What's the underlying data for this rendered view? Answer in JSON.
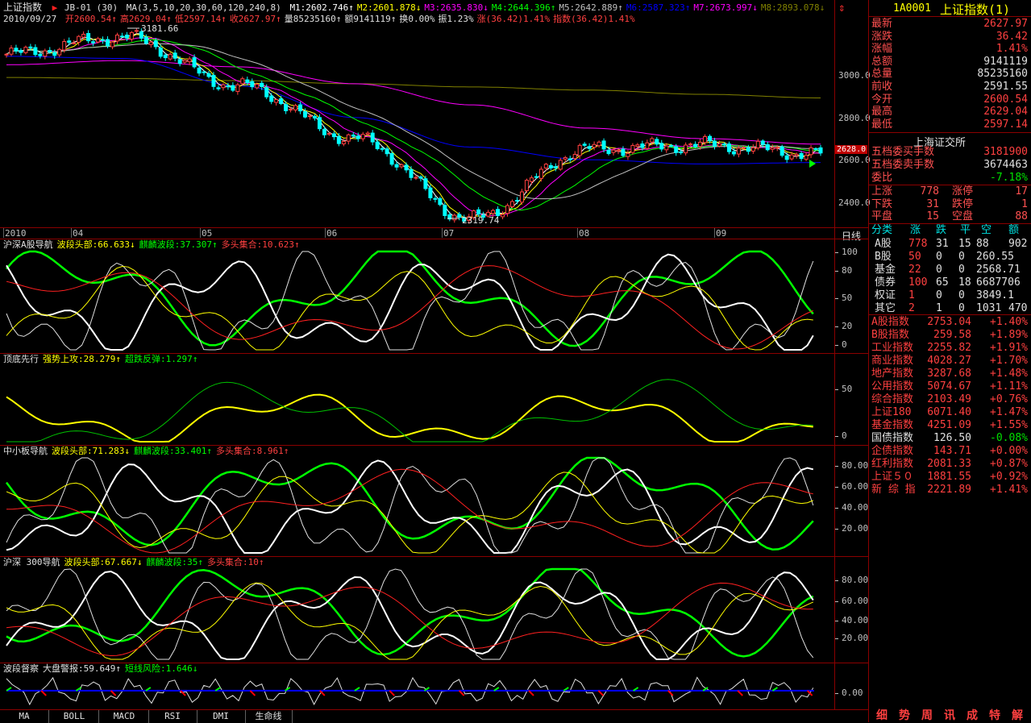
{
  "title": {
    "name": "上证指数",
    "formula": "JB-01 (30)",
    "ma_params": "MA(3,5,10,20,30,60,120,240,8)",
    "date": "2010/09/27"
  },
  "ma_values": [
    {
      "label": "M1:2602.746",
      "color": "#ffffff",
      "arrow": "↑"
    },
    {
      "label": "M2:2601.878",
      "color": "#ffff00",
      "arrow": "↓"
    },
    {
      "label": "M3:2635.830",
      "color": "#ff00ff",
      "arrow": "↓"
    },
    {
      "label": "M4:2644.396",
      "color": "#00ff00",
      "arrow": "↑"
    },
    {
      "label": "M5:2642.889",
      "color": "#c0c0c0",
      "arrow": "↑"
    },
    {
      "label": "M6:2587.323",
      "color": "#0000ff",
      "arrow": "↑"
    },
    {
      "label": "M7:2673.997",
      "color": "#ff00ff",
      "arrow": "↓"
    },
    {
      "label": "M8:2893.078",
      "color": "#808000",
      "arrow": "↓"
    }
  ],
  "ohlc_line": [
    {
      "label": "开2600.54",
      "color": "#ff4040",
      "arrow": "↑"
    },
    {
      "label": "高2629.04",
      "color": "#ff4040",
      "arrow": "↑"
    },
    {
      "label": "低2597.14",
      "color": "#ff4040",
      "arrow": "↑"
    },
    {
      "label": "收2627.97",
      "color": "#ff4040",
      "arrow": "↑"
    },
    {
      "label": "量85235160",
      "color": "#e0e0e0",
      "arrow": "↑"
    },
    {
      "label": "额9141119",
      "color": "#e0e0e0",
      "arrow": "↑"
    },
    {
      "label": "换0.00%",
      "color": "#e0e0e0",
      "arrow": ""
    },
    {
      "label": "振1.23%",
      "color": "#e0e0e0",
      "arrow": ""
    },
    {
      "label": "涨(36.42)1.41%",
      "color": "#ff4040",
      "arrow": ""
    },
    {
      "label": "指数(36.42)1.41%",
      "color": "#ff4040",
      "arrow": ""
    }
  ],
  "main_chart": {
    "y_ticks": [
      "3000.0",
      "2800.0",
      "2600.0",
      "2400.0"
    ],
    "high_label": "3181.66",
    "low_label": "2319.74",
    "current_tag": "2628.0",
    "months": [
      "2010",
      "04",
      "05",
      "06",
      "07",
      "08",
      "09"
    ],
    "period_label": "日线"
  },
  "panels": [
    {
      "name": "沪深A股导航",
      "items": [
        {
          "label": "波段头部:66.633",
          "arrow": "↓",
          "color": "#ffff00"
        },
        {
          "label": "麒麟波段:37.307",
          "arrow": "↑",
          "color": "#00ff00"
        },
        {
          "label": "多头集合:10.623",
          "arrow": "↑",
          "color": "#ff4040"
        }
      ],
      "ticks": [
        "100",
        "80",
        "50",
        "20",
        "0"
      ]
    },
    {
      "name": "顶底先行",
      "items": [
        {
          "label": "强势上攻:28.279",
          "arrow": "↑",
          "color": "#ffff00"
        },
        {
          "label": "超跌反弹:1.297",
          "arrow": "↑",
          "color": "#00ff00"
        }
      ],
      "ticks": [
        "50",
        "0"
      ]
    },
    {
      "name": "中小板导航",
      "items": [
        {
          "label": "波段头部:71.283",
          "arrow": "↓",
          "color": "#ffff00"
        },
        {
          "label": "麒麟波段:33.401",
          "arrow": "↑",
          "color": "#00ff00"
        },
        {
          "label": "多头集合:8.961",
          "arrow": "↑",
          "color": "#ff4040"
        }
      ],
      "ticks": [
        "80.00",
        "60.00",
        "40.00",
        "20.00"
      ]
    },
    {
      "name": "沪深 300导航",
      "items": [
        {
          "label": "波段头部:67.667",
          "arrow": "↓",
          "color": "#ffff00"
        },
        {
          "label": "麒麟波段:35",
          "arrow": "↑",
          "color": "#00ff00"
        },
        {
          "label": "多头集合:10",
          "arrow": "↑",
          "color": "#ff4040"
        }
      ],
      "ticks": [
        "80.00",
        "60.00",
        "40.00",
        "20.00"
      ]
    },
    {
      "name": "波段督察",
      "items": [
        {
          "label": "大盘警报:59.649",
          "arrow": "↑",
          "color": "#e0e0e0"
        },
        {
          "label": "短线风险:1.646",
          "arrow": "↓",
          "color": "#00ff00"
        }
      ],
      "ticks": [
        "0.00"
      ]
    }
  ],
  "tabs": [
    "MA",
    "BOLL",
    "MACD",
    "RSI",
    "DMI",
    "生命线"
  ],
  "right_panel": {
    "code": "1A0001",
    "name": "上证指数(1)",
    "quote": [
      {
        "k": "最新",
        "v": "2627.97",
        "vc": "red"
      },
      {
        "k": "涨跌",
        "v": "36.42",
        "vc": "red"
      },
      {
        "k": "涨幅",
        "v": "1.41%",
        "vc": "red"
      },
      {
        "k": "总额",
        "v": "9141119",
        "vc": "wht"
      },
      {
        "k": "总量",
        "v": "85235160",
        "vc": "wht"
      },
      {
        "k": "前收",
        "v": "2591.55",
        "vc": "wht"
      },
      {
        "k": "今开",
        "v": "2600.54",
        "vc": "red"
      },
      {
        "k": "最高",
        "v": "2629.04",
        "vc": "red"
      },
      {
        "k": "最低",
        "v": "2597.14",
        "vc": "red"
      }
    ],
    "exchange": "上海证交所",
    "orders": [
      {
        "k": "五档委买手数",
        "v": "3181900",
        "vc": "red"
      },
      {
        "k": "五档委卖手数",
        "v": "3674463",
        "vc": "wht"
      },
      {
        "k": "委比",
        "v": "-7.18%",
        "vc": "grn"
      }
    ],
    "breadth": [
      {
        "k1": "上涨",
        "v1": "778",
        "k2": "涨停",
        "v2": "17"
      },
      {
        "k1": "下跌",
        "v1": "31",
        "k2": "跌停",
        "v2": "1"
      },
      {
        "k1": "平盘",
        "v1": "15",
        "k2": "空盘",
        "v2": "88"
      }
    ],
    "class_header": [
      "分类",
      "涨",
      "跌",
      "平",
      "空",
      "额"
    ],
    "classes": [
      {
        "k": "A股",
        "c": [
          "778",
          "31",
          "15",
          "88",
          "902"
        ]
      },
      {
        "k": "B股",
        "c": [
          "50",
          "0",
          "0",
          "260.55"
        ]
      },
      {
        "k": "基金",
        "c": [
          "22",
          "0",
          "0",
          "2568.71"
        ]
      },
      {
        "k": "债券",
        "c": [
          "100",
          "65",
          "18",
          "6687706"
        ]
      },
      {
        "k": "权证",
        "c": [
          "1",
          "0",
          "0",
          "3849.1"
        ]
      },
      {
        "k": "其它",
        "c": [
          "2",
          "1",
          "0",
          "1031",
          "470"
        ]
      }
    ],
    "indices": [
      {
        "k": "A股指数",
        "v": "2753.04",
        "p": "+1.40%",
        "c": "red"
      },
      {
        "k": "B股指数",
        "v": "259.58",
        "p": "+1.89%",
        "c": "red"
      },
      {
        "k": "工业指数",
        "v": "2255.82",
        "p": "+1.91%",
        "c": "red"
      },
      {
        "k": "商业指数",
        "v": "4028.27",
        "p": "+1.70%",
        "c": "red"
      },
      {
        "k": "地产指数",
        "v": "3287.68",
        "p": "+1.48%",
        "c": "red"
      },
      {
        "k": "公用指数",
        "v": "5074.67",
        "p": "+1.11%",
        "c": "red"
      },
      {
        "k": "综合指数",
        "v": "2103.49",
        "p": "+0.76%",
        "c": "red"
      },
      {
        "k": "上证180",
        "v": "6071.40",
        "p": "+1.47%",
        "c": "red"
      },
      {
        "k": "基金指数",
        "v": "4251.09",
        "p": "+1.55%",
        "c": "red"
      },
      {
        "k": "国债指数",
        "v": "126.50",
        "p": "-0.08%",
        "c": "grn"
      },
      {
        "k": "企债指数",
        "v": "143.71",
        "p": "+0.00%",
        "c": "red"
      },
      {
        "k": "红利指数",
        "v": "2081.33",
        "p": "+0.87%",
        "c": "red"
      },
      {
        "k": "上证５０",
        "v": "1881.55",
        "p": "+0.92%",
        "c": "red"
      },
      {
        "k": "新 综 指",
        "v": "2221.89",
        "p": "+1.41%",
        "c": "red"
      }
    ],
    "bottom_tabs": [
      "细",
      "势",
      "周",
      "讯",
      "成",
      "特",
      "解"
    ]
  },
  "chart_data": {
    "type": "line",
    "title": "上证指数",
    "period": "日线",
    "ylim": [
      2280,
      3250
    ],
    "x": [
      "2010",
      "04",
      "05",
      "06",
      "07",
      "08",
      "09"
    ],
    "series": [
      {
        "name": "M8",
        "values": [
          2990,
          2985,
          2975,
          2960,
          2945,
          2930,
          2910,
          2893
        ]
      },
      {
        "name": "M7",
        "values": [
          3050,
          3070,
          3040,
          2960,
          2860,
          2750,
          2700,
          2674
        ]
      },
      {
        "name": "M6",
        "values": [
          3090,
          3080,
          2950,
          2800,
          2660,
          2600,
          2580,
          2587
        ]
      },
      {
        "name": "price",
        "values": [
          3100,
          3181.66,
          2950,
          2700,
          2319.74,
          2650,
          2670,
          2627.97
        ]
      }
    ],
    "annotations": [
      {
        "label": "3181.66"
      },
      {
        "label": "2319.74"
      }
    ]
  }
}
